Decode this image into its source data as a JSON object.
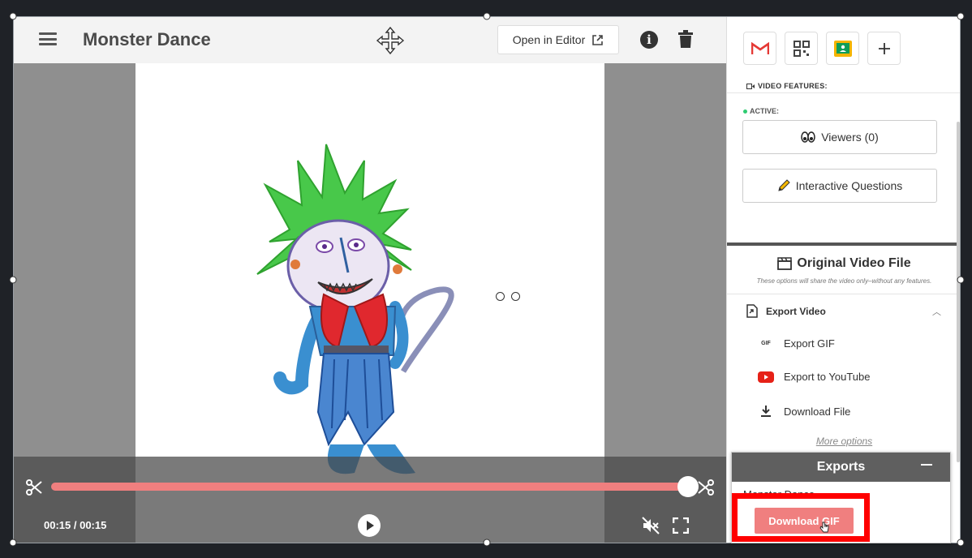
{
  "header": {
    "title": "Monster Dance",
    "open_editor_label": "Open in Editor"
  },
  "player": {
    "time": "00:15 / 00:15",
    "progress": 1.0
  },
  "sidebar": {
    "video_features_label": "VIDEO FEATURES:",
    "active_label": "ACTIVE:",
    "viewers_label": "Viewers (0)",
    "interactive_questions_label": "Interactive Questions",
    "original_file_title": "Original Video File",
    "original_file_subtitle": "These options will share the video only–without any features.",
    "export_video_label": "Export Video",
    "options": [
      {
        "label": "Export GIF",
        "icon": "gif-icon"
      },
      {
        "label": "Export to YouTube",
        "icon": "youtube-icon"
      },
      {
        "label": "Download File",
        "icon": "download-icon"
      }
    ],
    "more_options_label": "More options"
  },
  "exports": {
    "title": "Exports",
    "item_label": "Monster Dance",
    "download_gif_label": "Download GIF"
  },
  "colors": {
    "accent": "#f07f7f",
    "highlight": "#ff0000",
    "popup_header": "#5f5f5f"
  }
}
